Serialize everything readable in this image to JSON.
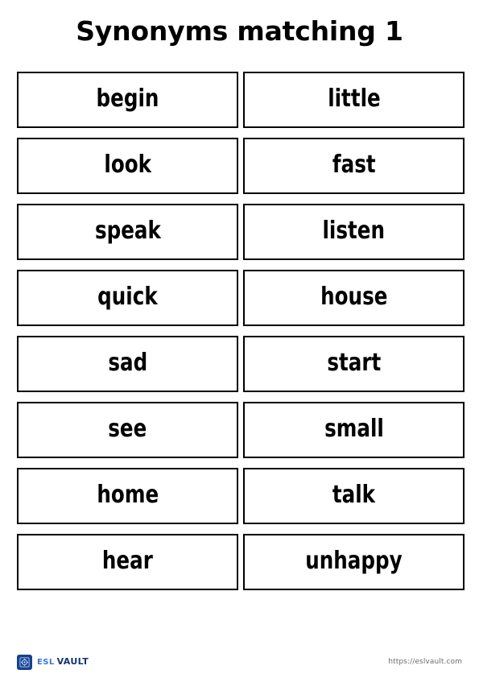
{
  "worksheet": {
    "title": "Synonyms matching 1",
    "cards": [
      {
        "left": "begin",
        "right": "little"
      },
      {
        "left": "look",
        "right": "fast"
      },
      {
        "left": "speak",
        "right": "listen"
      },
      {
        "left": "quick",
        "right": "house"
      },
      {
        "left": "sad",
        "right": "start"
      },
      {
        "left": "see",
        "right": "small"
      },
      {
        "left": "home",
        "right": "talk"
      },
      {
        "left": "hear",
        "right": "unhappy"
      }
    ]
  },
  "footer": {
    "brand_primary": "ESL",
    "brand_secondary": "Vault",
    "url": "https://eslvault.com",
    "icon": "vault-logo-icon",
    "brand_primary_color": "#3f77d4",
    "brand_secondary_color": "#15346e",
    "icon_color": "#17418f",
    "url_color": "#6d6d6d"
  }
}
